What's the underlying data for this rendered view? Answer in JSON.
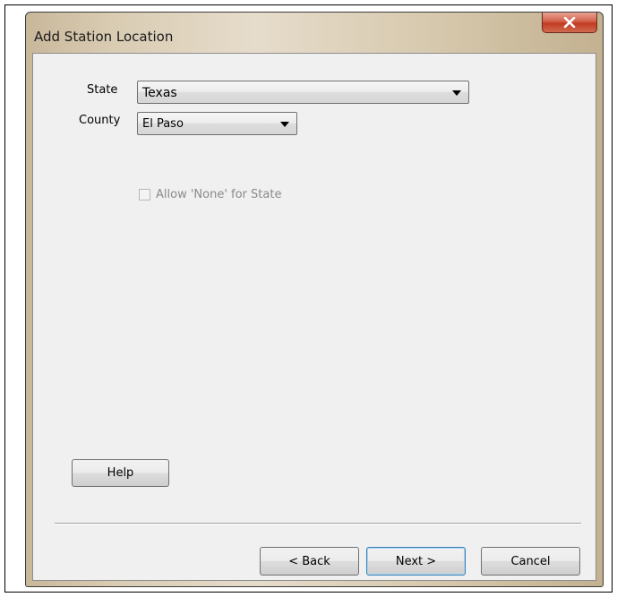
{
  "window": {
    "title": "Add Station Location",
    "close_icon": "close-x-icon"
  },
  "form": {
    "state": {
      "label": "State",
      "value": "Texas"
    },
    "county": {
      "label": "County",
      "value": "El Paso"
    },
    "allow_none": {
      "label": "Allow 'None' for State",
      "checked": false,
      "enabled": false
    }
  },
  "buttons": {
    "help": "Help",
    "back": "< Back",
    "next": "Next >",
    "cancel": "Cancel"
  },
  "colors": {
    "close_button": "#c23b22",
    "default_button_border": "#3c7fb1"
  }
}
